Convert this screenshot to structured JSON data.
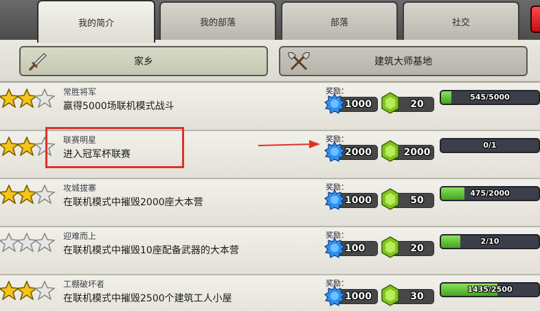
{
  "tabs": [
    {
      "label": "我的简介",
      "active": true
    },
    {
      "label": "我的部落",
      "active": false
    },
    {
      "label": "部落",
      "active": false
    },
    {
      "label": "社交",
      "active": false
    }
  ],
  "subtabs": [
    {
      "label": "家乡",
      "icon": "sword-icon",
      "active": true
    },
    {
      "label": "建筑大师基地",
      "icon": "crossed-axes-icon",
      "active": false
    }
  ],
  "reward_label": "奖励：",
  "achievements": [
    {
      "title": "常胜将军",
      "desc": "赢得5000场联机模式战斗",
      "stars": 2,
      "elixir": "1000",
      "gems": "20",
      "progress_text": "545/5000",
      "progress_fraction": 0.109
    },
    {
      "title": "联赛明星",
      "desc": "进入冠军杯联赛",
      "stars": 2,
      "elixir": "2000",
      "gems": "2000",
      "progress_text": "0/1",
      "progress_fraction": 0
    },
    {
      "title": "攻城拔寨",
      "desc": "在联机模式中摧毁2000座大本营",
      "stars": 2,
      "elixir": "1000",
      "gems": "50",
      "progress_text": "475/2000",
      "progress_fraction": 0.2375
    },
    {
      "title": "迎难而上",
      "desc": "在联机模式中摧毁10座配备武器的大本营",
      "stars": 0,
      "elixir": "100",
      "gems": "20",
      "progress_text": "2/10",
      "progress_fraction": 0.2
    },
    {
      "title": "工棚破坏者",
      "desc": "在联机模式中摧毁2500个建筑工人小屋",
      "stars": 2,
      "elixir": "1000",
      "gems": "30",
      "progress_text": "1435/2500",
      "progress_fraction": 0.574
    }
  ],
  "colors": {
    "star_gold": "#f5c518",
    "star_empty": "#e6e6e6",
    "elixir_blue": "#2f8ff0",
    "gem_green": "#7ec51c",
    "progress_green": "#5cc234",
    "highlight_red": "#e0302a"
  }
}
